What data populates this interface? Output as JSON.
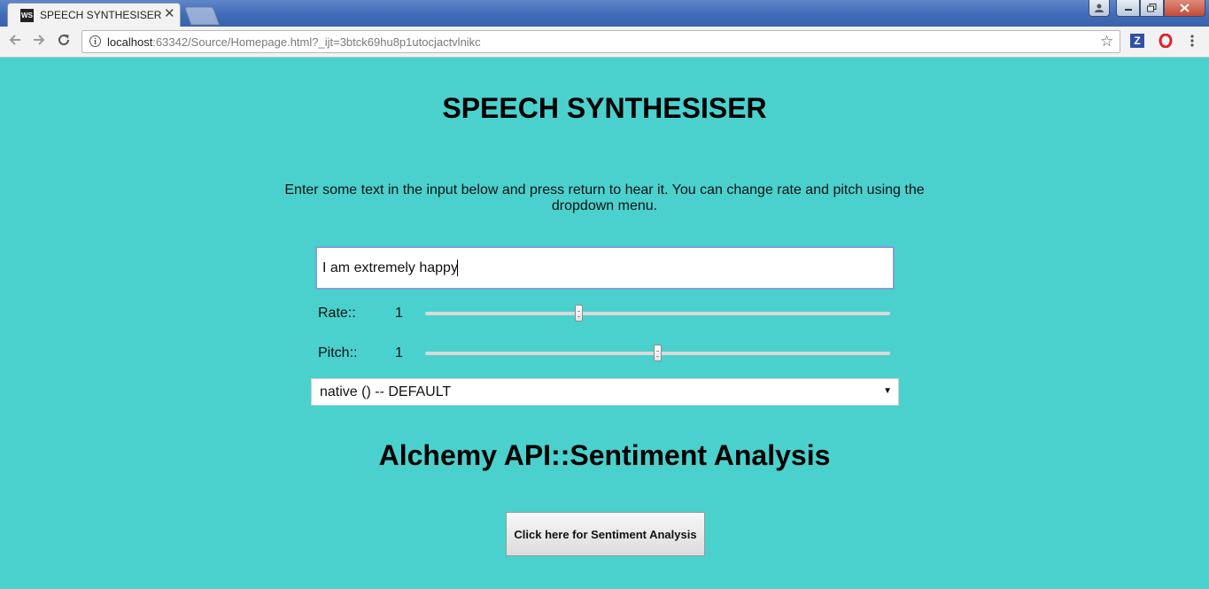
{
  "browser": {
    "tab_title": "SPEECH SYNTHESISER",
    "favicon_text": "WS",
    "url_host": "localhost",
    "url_rest": ":63342/Source/Homepage.html?_ijt=3btck69hu8p1utocjactvlnikc",
    "extension_z_label": "Z"
  },
  "page": {
    "title": "SPEECH SYNTHESISER",
    "instructions": "Enter some text in the input below and press return to hear it. You can change rate and pitch using the dropdown menu.",
    "text_input_value": "I am extremely happy",
    "rate": {
      "label": "Rate::",
      "value": "1",
      "slider_fraction": 0.33
    },
    "pitch": {
      "label": "Pitch::",
      "value": "1",
      "slider_fraction": 0.5
    },
    "voice_select_value": "native () -- DEFAULT",
    "section_title": "Alchemy API::Sentiment Analysis",
    "analysis_button_label": "Click here for Sentiment Analysis"
  },
  "colors": {
    "page_background": "#4ad1cd",
    "input_border": "#7da0d8"
  },
  "icons": [
    "back-arrow-icon",
    "forward-arrow-icon",
    "reload-icon",
    "info-icon",
    "star-icon",
    "opera-icon",
    "menu-icon",
    "close-icon"
  ]
}
